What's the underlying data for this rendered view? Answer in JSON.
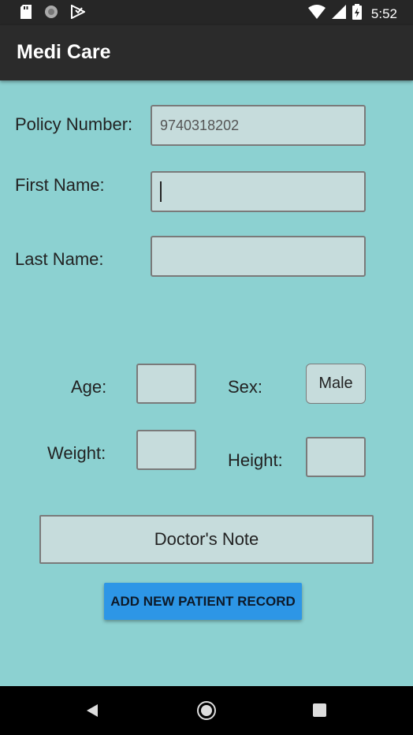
{
  "status_bar": {
    "time": "5:52",
    "icons": [
      "sd-card-icon",
      "sync-icon",
      "play-store-icon",
      "wifi-icon",
      "signal-icon",
      "battery-charging-icon"
    ]
  },
  "app_bar": {
    "title": "Medi Care"
  },
  "form": {
    "policy_label": "Policy Number:",
    "policy_placeholder": "9740318202",
    "first_name_label": "First Name:",
    "first_name_value": "",
    "last_name_label": "Last Name:",
    "last_name_value": "",
    "age_label": "Age:",
    "age_value": "",
    "sex_label": "Sex:",
    "sex_value": "Male",
    "weight_label": "Weight:",
    "weight_value": "",
    "height_label": "Height:",
    "height_value": ""
  },
  "buttons": {
    "doctors_note": "Doctor's Note",
    "add_record": "ADD NEW PATIENT RECORD"
  },
  "nav_bar": {
    "icons": [
      "back-icon",
      "home-icon",
      "recents-icon"
    ]
  },
  "colors": {
    "background": "#8cd1d1",
    "app_bar": "#2b2b2b",
    "field": "#c6dcdc",
    "accent": "#2d96e6"
  }
}
